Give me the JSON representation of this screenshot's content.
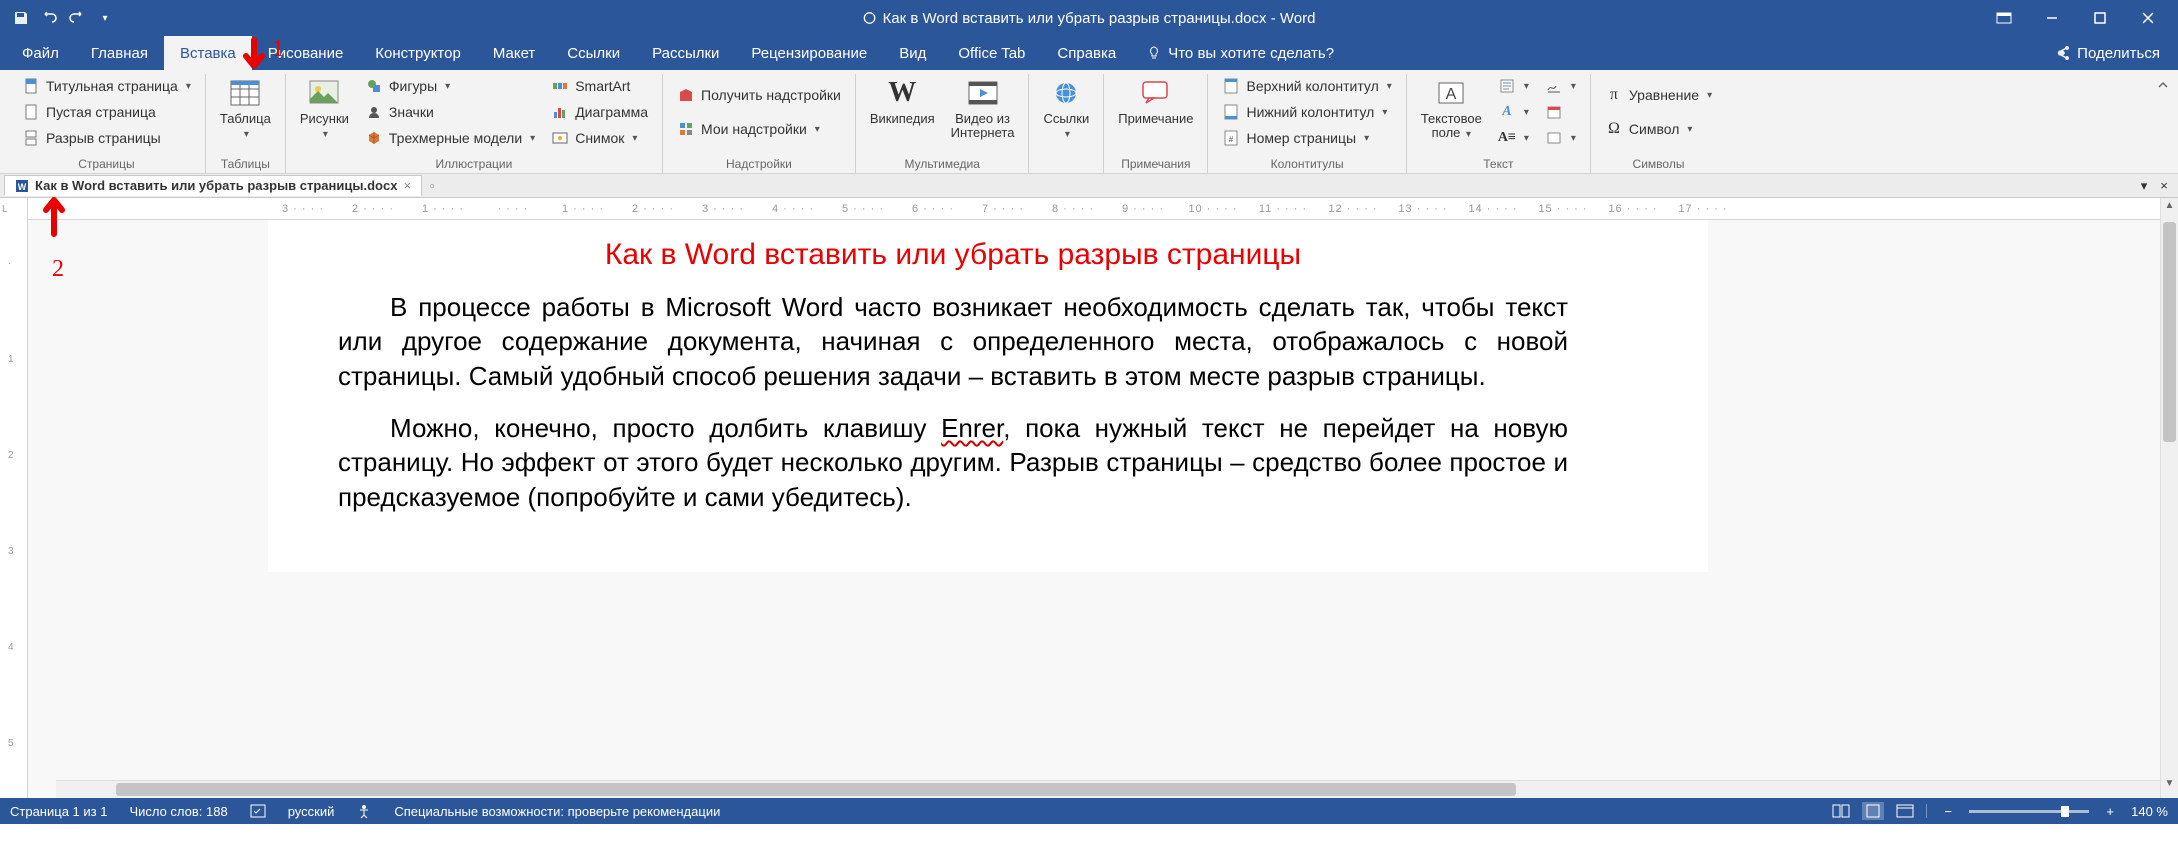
{
  "colors": {
    "brand": "#2b579a",
    "accent_red": "#e80000"
  },
  "title_bar": {
    "doc_title": "Как в Word вставить или убрать разрыв страницы.docx  -  Word"
  },
  "qat": {
    "save": "save",
    "undo": "undo",
    "redo": "redo",
    "customize": "▾"
  },
  "tabs": {
    "file": "Файл",
    "home": "Главная",
    "insert": "Вставка",
    "draw": "Рисование",
    "design": "Конструктор",
    "layout": "Макет",
    "references": "Ссылки",
    "mailings": "Рассылки",
    "review": "Рецензирование",
    "view": "Вид",
    "office_tab": "Office Tab",
    "help": "Справка",
    "tell_me": "Что вы хотите сделать?",
    "share": "Поделиться"
  },
  "ribbon": {
    "pages": {
      "group_label": "Страницы",
      "cover_page": "Титульная страница",
      "blank_page": "Пустая страница",
      "page_break": "Разрыв страницы"
    },
    "tables": {
      "group_label": "Таблицы",
      "table": "Таблица"
    },
    "illustrations": {
      "group_label": "Иллюстрации",
      "pictures": "Рисунки",
      "shapes": "Фигуры",
      "icons": "Значки",
      "models3d": "Трехмерные модели",
      "smartart": "SmartArt",
      "chart": "Диаграмма",
      "screenshot": "Снимок"
    },
    "addins": {
      "group_label": "Надстройки",
      "get_addins": "Получить надстройки",
      "my_addins": "Мои надстройки"
    },
    "media": {
      "group_label": "Мультимедиа",
      "wikipedia": "Википедия",
      "online_video": "Видео из\nИнтернета"
    },
    "links": {
      "group_label": "",
      "links_btn": "Ссылки"
    },
    "comments": {
      "group_label": "Примечания",
      "comment": "Примечание"
    },
    "header_footer": {
      "group_label": "Колонтитулы",
      "header": "Верхний колонтитул",
      "footer": "Нижний колонтитул",
      "page_number": "Номер страницы"
    },
    "text": {
      "group_label": "Текст",
      "text_box": "Текстовое\nполе"
    },
    "symbols": {
      "group_label": "Символы",
      "equation": "Уравнение",
      "symbol": "Символ"
    }
  },
  "annotations": {
    "arrow1": "1",
    "arrow2": "2"
  },
  "doc_tab": {
    "name": "Как в Word вставить или убрать разрыв страницы.docx"
  },
  "ruler_h": [
    "3",
    "2",
    "1",
    "",
    "1",
    "2",
    "3",
    "4",
    "5",
    "6",
    "7",
    "8",
    "9",
    "10",
    "11",
    "12",
    "13",
    "14",
    "15",
    "16",
    "17"
  ],
  "document": {
    "heading": "Как в Word вставить или убрать разрыв страницы",
    "p1": "В процессе работы в Microsoft Word часто возникает необходимость сделать так, чтобы текст или другое содержание документа, начиная с определенного места, отображалось с новой страницы. Самый удобный способ решения задачи – вставить в этом месте разрыв страницы.",
    "p2_a": "Можно, конечно, просто долбить клавишу ",
    "p2_err": "Enrer",
    "p2_b": ", пока нужный текст не перейдет на новую страницу. Но эффект от этого будет несколько другим. Разрыв страницы – средство более простое и предсказуемое (попробуйте и сами убедитесь)."
  },
  "status": {
    "page": "Страница 1 из 1",
    "words": "Число слов: 188",
    "language": "русский",
    "accessibility": "Специальные возможности: проверьте рекомендации",
    "zoom": "140 %"
  }
}
